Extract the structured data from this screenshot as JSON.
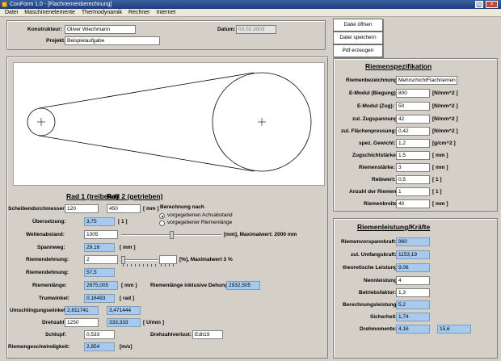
{
  "window": {
    "title": "ConForm 1.0 - [Flachriemenberechnung]"
  },
  "menu": [
    "Datei",
    "Maschinenelemente",
    "Thermodynamik",
    "Rechner",
    "Internet"
  ],
  "header": {
    "konstrukteur_label": "Konstrukteur:",
    "konstrukteur_value": "Oliver Wiechmann",
    "projekt_label": "Projekt:",
    "projekt_value": "Beispielaufgabe",
    "datum_label": "Datum:",
    "datum_value": "03.02.2003"
  },
  "actions": {
    "open": "Datei öffnen",
    "save": "Datei speichern",
    "pdf": "Pdf erzeugen"
  },
  "wheels": {
    "rad1": "Rad 1 (treibend)",
    "rad2": "Rad 2 (getrieben)"
  },
  "calc": {
    "durchmesser_label": "Scheibendurchmesser:",
    "d1": "120",
    "d2": "450",
    "mm_unit": "[ mm ]",
    "berechnung_label": "Berechnung nach",
    "opt_achsabstand": "vorgegebenen Achsabstand",
    "opt_riemenlaenge": "vorgegebener Riemenlänge",
    "uebersetzung_label": "Übersetzung:",
    "uebersetzung_value": "3,75",
    "uebersetzung_unit": "[ 1 ]",
    "wellenabstand_label": "Wellenabstand:",
    "wellenabstand_value": "1005",
    "wellenabstand_unit": "[mm], Maximalwert: 2000 mm",
    "wellenabstand_fraction": 0.5,
    "spannweg_label": "Spannweg:",
    "spannweg_value": "29,16",
    "spannweg_unit": "[ mm ]",
    "riemendehnung_label": "Riemendehnung:",
    "riemendehnung_value": "2",
    "riemendehnung_unit": "[%], Maximalwert 3 %",
    "riemendehnung_fraction": 0.0,
    "riemendehnung2_label": "Riemendehnung:",
    "riemendehnung2_value": "57,5",
    "riemenlaenge_label": "Riemenlänge:",
    "riemenlaenge_value": "2875,005",
    "riemenlaenge_unit": "[ mm ]",
    "riemenlaenge_dehnung_label": "Riemenlänge inklusive Dehung:",
    "riemenlaenge_dehnung_value": "2932,505",
    "trumwinkel_label": "Trumwinkel:",
    "trumwinkel_value": "0,16493",
    "trumwinkel_unit": "[ rad ]",
    "umschlingung_label": "Umschlingungswinkel:",
    "umschlingung_1": "2,811741",
    "umschlingung_2": "3,471444",
    "drehzahl_label": "Drehzahl:",
    "drehzahl_1": "1250",
    "drehzahl_2": "333,333",
    "drehzahl_unit": "[ U/min ]",
    "schlupf_label": "Schlupf:",
    "schlupf_value": "0,533",
    "drehzahlverlust_label": "Drehzahlverlust:",
    "drehzahlverlust_value": "Edit19",
    "geschwindigkeit_label": "Riemengeschwindigkeit:",
    "geschwindigkeit_value": "2,854",
    "geschwindigkeit_unit": "[m/s]"
  },
  "spec": {
    "title": "Riemenspezifikation",
    "bezeichnung_label": "Riemenbezeichnung:",
    "bezeichnung_value": "MehrschichtFlachriemen (",
    "emodul_biegung_label": "E-Modul (Biegung):",
    "emodul_biegung_value": "800",
    "emodul_zug_label": "E-Modul (Zug):",
    "emodul_zug_value": "50",
    "zugspannung_label": "zul. Zugspannung:",
    "zugspannung_value": "42",
    "flaechenpressung_label": "zul. Flächenpressung:",
    "flaechenpressung_value": "0,42",
    "gewicht_label": "spez. Gewicht:",
    "gewicht_value": "1,2",
    "zugschicht_label": "Zugschichtstärke:",
    "zugschicht_value": "1,5",
    "riemenstaerke_label": "Riemenstärke:",
    "riemenstaerke_value": "3",
    "reibwert_label": "Reibwert:",
    "reibwert_value": "0,5",
    "anzahl_label": "Anzahl der Riemen:",
    "anzahl_value": "1",
    "breite_label": "Riemenbreite:",
    "breite_value": "40",
    "unit_nmm2": "[N/mm^2 ]",
    "unit_gcm3": "[g/cm^2 ]",
    "unit_mm": "[ mm ]",
    "unit_1": "[ 1 ]"
  },
  "forces": {
    "title": "Riemenleistung/Kräfte",
    "vorspann_label": "Riemenvorspannkraft:",
    "vorspann_value": "960",
    "umfang_label": "zul. Umfangskraft:",
    "umfang_value": "1153,19",
    "theor_label": "theoretische Leistung:",
    "theor_value": "9,06",
    "nenn_label": "Nennleistung:",
    "nenn_value": "4",
    "betrieb_label": "Betriebsfaktor:",
    "betrieb_value": "1,3",
    "berech_label": "Berechnungsleistung:",
    "berech_value": "5,2",
    "sicherheit_label": "Sicherheit:",
    "sicherheit_value": "1,74",
    "drehmoment_label": "Drehmomente:",
    "drehmoment_1": "4,16",
    "drehmoment_2": "15,6"
  }
}
